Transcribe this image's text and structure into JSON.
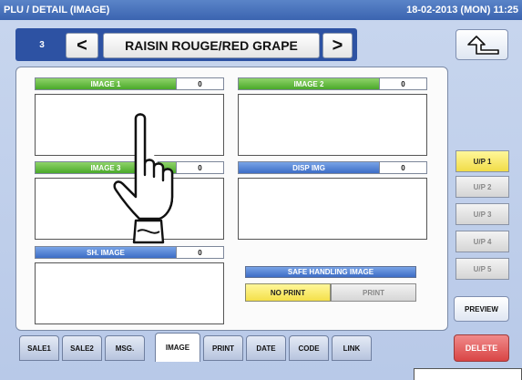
{
  "titlebar": {
    "title": "PLU / DETAIL (IMAGE)",
    "datetime": "18-02-2013 (MON)  11:25"
  },
  "nav": {
    "plu_number": "3",
    "prev_label": "<",
    "item_name": "RAISIN ROUGE/RED GRAPE",
    "next_label": ">"
  },
  "icons": {
    "return": "return-arrow-icon",
    "cursor": "hand-pointer-icon"
  },
  "slots": {
    "image1": {
      "label": "IMAGE 1",
      "value": "0"
    },
    "image2": {
      "label": "IMAGE 2",
      "value": "0"
    },
    "image3": {
      "label": "IMAGE 3",
      "value": "0"
    },
    "disp_img": {
      "label": "DISP IMG",
      "value": "0"
    },
    "sh_image": {
      "label": "SH. IMAGE",
      "value": "0"
    }
  },
  "safe_handling": {
    "title": "SAFE HANDLING IMAGE",
    "options": [
      "NO PRINT",
      "PRINT"
    ],
    "selected": "NO PRINT"
  },
  "pages": [
    "U/P 1",
    "U/P 2",
    "U/P 3",
    "U/P 4",
    "U/P 5"
  ],
  "active_page": "U/P 1",
  "actions": {
    "preview": "PREVIEW",
    "delete": "DELETE"
  },
  "tabs": [
    "SALE1",
    "SALE2",
    "MSG.",
    "IMAGE",
    "PRINT",
    "DATE",
    "CODE",
    "LINK"
  ],
  "active_tab": "IMAGE",
  "colors": {
    "title_bar": "#3b64b0",
    "green_header": "#4aa92a",
    "blue_header": "#3d6dc6",
    "selected_yellow": "#f4e04a",
    "delete_red": "#d94545"
  }
}
